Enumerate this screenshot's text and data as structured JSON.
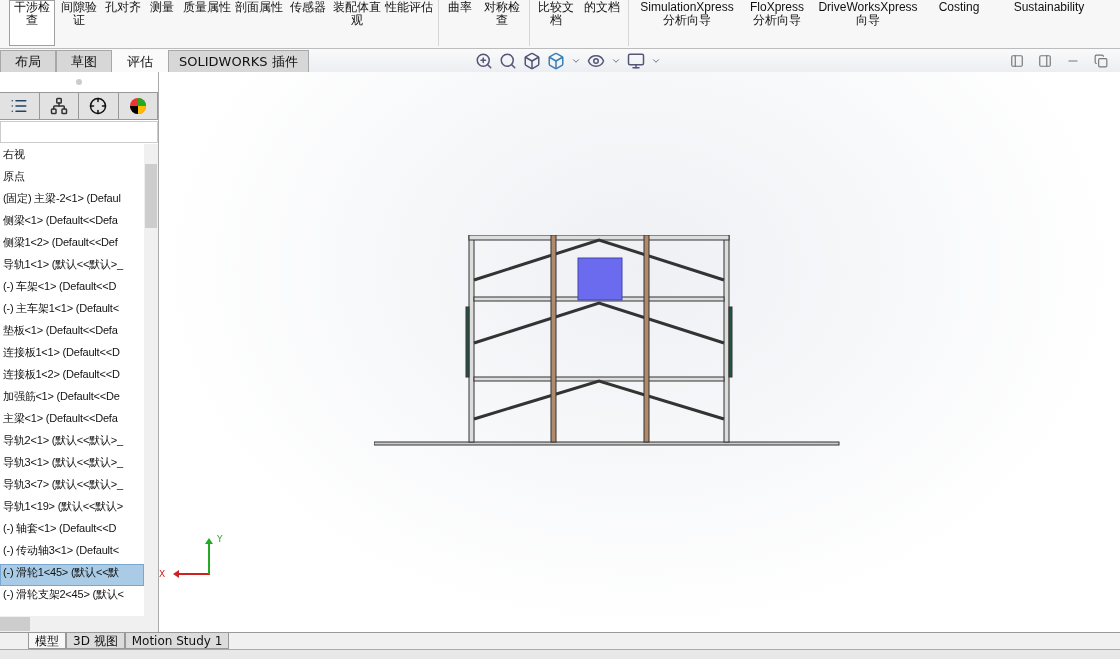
{
  "ribbon": {
    "commands": [
      {
        "label": "干涉检查",
        "selected": true
      },
      {
        "label": "间隙验证",
        "selected": false
      },
      {
        "label": "孔对齐",
        "selected": false
      },
      {
        "label": "测量",
        "selected": false
      },
      {
        "label": "质量属性",
        "selected": false
      },
      {
        "label": "剖面属性",
        "selected": false
      },
      {
        "label": "传感器",
        "selected": false
      },
      {
        "label": "装配体直观",
        "selected": false
      },
      {
        "label": "性能评估",
        "selected": false
      },
      {
        "label": "曲率",
        "selected": false
      },
      {
        "label": "对称检查",
        "selected": false
      },
      {
        "label": "比较文档",
        "selected": false
      },
      {
        "label": "的文档",
        "selected": false
      },
      {
        "label": "SimulationXpress 分析向导",
        "selected": false
      },
      {
        "label": "FloXpress 分析向导",
        "selected": false
      },
      {
        "label": "DriveWorksXpress 向导",
        "selected": false
      },
      {
        "label": "Costing",
        "selected": false
      },
      {
        "label": "Sustainability",
        "selected": false
      }
    ]
  },
  "tabs": [
    {
      "label": "布局",
      "selected": false
    },
    {
      "label": "草图",
      "selected": false
    },
    {
      "label": "评估",
      "selected": true
    },
    {
      "label": "SOLIDWORKS 插件",
      "selected": false
    }
  ],
  "tree": {
    "items": [
      {
        "label": "右视",
        "selected": false
      },
      {
        "label": "原点",
        "selected": false
      },
      {
        "label": "(固定) 主梁-2<1> (Defaul",
        "selected": false
      },
      {
        "label": "侧梁<1> (Default<<Defa",
        "selected": false
      },
      {
        "label": "侧梁1<2> (Default<<Def",
        "selected": false
      },
      {
        "label": "导轨1<1> (默认<<默认>_",
        "selected": false
      },
      {
        "label": "(-) 车架<1> (Default<<D",
        "selected": false
      },
      {
        "label": "(-) 主车架1<1> (Default<",
        "selected": false
      },
      {
        "label": "垫板<1> (Default<<Defa",
        "selected": false
      },
      {
        "label": "连接板1<1> (Default<<D",
        "selected": false
      },
      {
        "label": "连接板1<2> (Default<<D",
        "selected": false
      },
      {
        "label": "加强筋<1> (Default<<De",
        "selected": false
      },
      {
        "label": "主梁<1> (Default<<Defa",
        "selected": false
      },
      {
        "label": "导轨2<1> (默认<<默认>_",
        "selected": false
      },
      {
        "label": "导轨3<1> (默认<<默认>_",
        "selected": false
      },
      {
        "label": "导轨3<7> (默认<<默认>_",
        "selected": false
      },
      {
        "label": "导轨1<19> (默认<<默认>",
        "selected": false
      },
      {
        "label": "(-) 轴套<1> (Default<<D",
        "selected": false
      },
      {
        "label": "(-) 传动轴3<1> (Default<",
        "selected": false
      },
      {
        "label": "(-) 滑轮1<45> (默认<<默",
        "selected": true
      },
      {
        "label": "(-) 滑轮支架2<45> (默认<",
        "selected": false
      }
    ]
  },
  "triad": {
    "x_label": "X",
    "y_label": "Y"
  },
  "bottom_tabs": [
    {
      "label": "模型",
      "selected": true
    },
    {
      "label": "3D 视图",
      "selected": false
    },
    {
      "label": "Motion Study 1",
      "selected": false
    }
  ]
}
